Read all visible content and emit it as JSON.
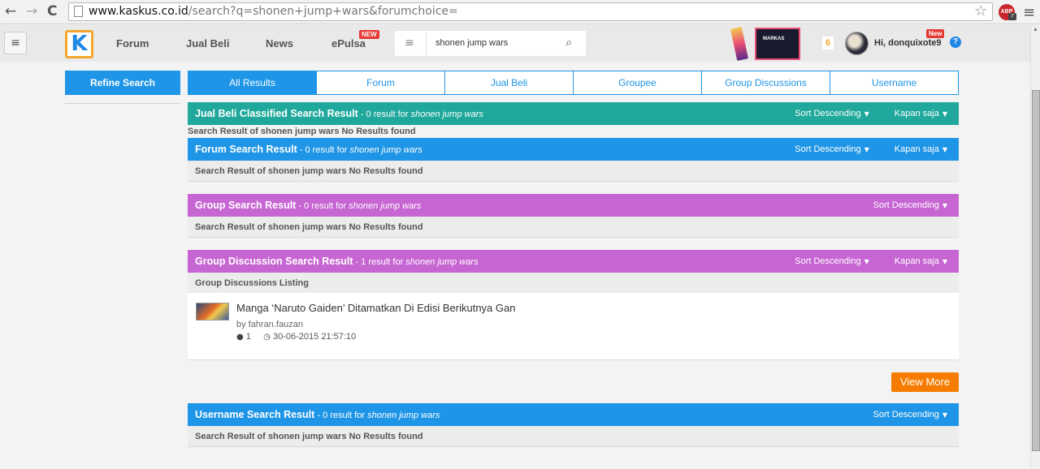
{
  "browser": {
    "url_domain": "www.kaskus.co.id",
    "url_path": "/search?q=shonen+jump+wars&forumchoice=",
    "back_glyph": "←",
    "forward_glyph": "→",
    "reload_glyph": "C",
    "star_glyph": "☆",
    "abp_label": "ABP",
    "abp_badge": "7",
    "menu_glyph": "≡"
  },
  "header": {
    "hamburger_glyph": "≡",
    "logo_glyph": "K",
    "nav": [
      {
        "label": "Forum"
      },
      {
        "label": "Jual Beli"
      },
      {
        "label": "News"
      },
      {
        "label": "ePulsa",
        "badge": "NEW"
      }
    ],
    "search": {
      "list_glyph": "≡",
      "value": "shonen jump wars",
      "icon_glyph": "⌕"
    },
    "banner_text": "MARKAS",
    "notification_count": "6",
    "greeting": "Hi, donquixote9",
    "greeting_badge": "New",
    "help_glyph": "?"
  },
  "sidebar": {
    "refine_label": "Refine Search"
  },
  "tabs": [
    {
      "label": "All Results",
      "active": true
    },
    {
      "label": "Forum"
    },
    {
      "label": "Jual Beli"
    },
    {
      "label": "Groupee"
    },
    {
      "label": "Group Discussions"
    },
    {
      "label": "Username"
    }
  ],
  "sections": {
    "jualbeli": {
      "title": "Jual Beli Classified Search Result",
      "count": " - 0 result for ",
      "query": "shonen jump wars",
      "sort": "Sort Descending",
      "time": "Kapan saja",
      "body": "Search Result of shonen jump wars No Results found"
    },
    "forum": {
      "title": "Forum Search Result",
      "count": " - 0 result for ",
      "query": "shonen jump wars",
      "sort": "Sort Descending",
      "time": "Kapan saja",
      "body": "Search Result of shonen jump wars No Results found"
    },
    "group": {
      "title": "Group Search Result",
      "count": " - 0 result for ",
      "query": "shonen jump wars",
      "sort": "Sort Descending",
      "body": "Search Result of shonen jump wars No Results found"
    },
    "groupdisc": {
      "title": "Group Discussion Search Result",
      "count": " - 1 result for ",
      "query": "shonen jump wars",
      "sort": "Sort Descending",
      "time": "Kapan saja",
      "body": "Group Discussions Listing"
    },
    "username": {
      "title": "Username Search Result",
      "count": " - 0 result for ",
      "query": "shonen jump wars",
      "sort": "Sort Descending",
      "body": "Search Result of shonen jump wars No Results found"
    }
  },
  "caret_glyph": "▼",
  "post": {
    "title": "Manga ‘Naruto Gaiden’ Ditamatkan Di Edisi Berikutnya Gan",
    "author": "by fahran.fauzan",
    "comment_glyph": "●",
    "comments": "1",
    "clock_glyph": "◷",
    "date": "30-06-2015 21:57:10"
  },
  "view_more": "View More",
  "colors": {
    "blue": "#1e95e6",
    "teal": "#1fa89b",
    "purple": "#c765d3",
    "orange": "#f57c00"
  }
}
